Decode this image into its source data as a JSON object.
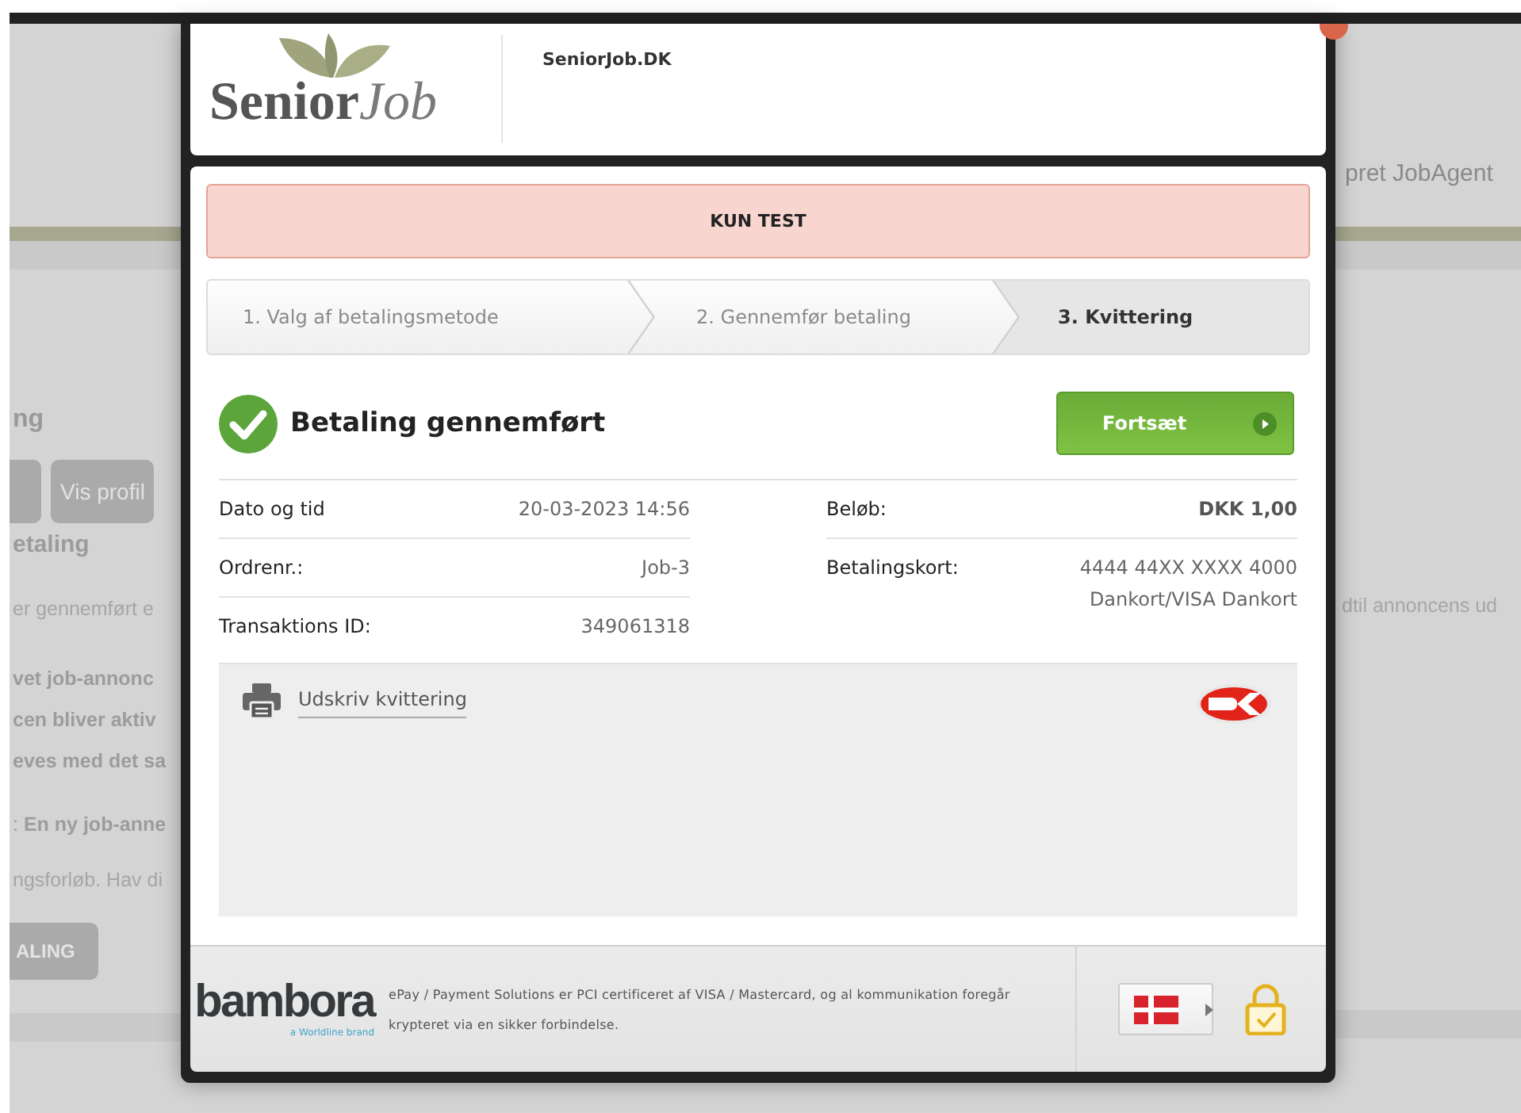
{
  "background_page": {
    "left": [
      {
        "kind": "heading",
        "text": "ng"
      },
      {
        "kind": "button_row",
        "buttons": [
          "Vis profil"
        ]
      },
      {
        "kind": "subheading",
        "text": "etaling"
      },
      {
        "kind": "text",
        "text": "er gennemført e"
      },
      {
        "kind": "bold",
        "text": "vet job-annonc"
      },
      {
        "kind": "bold",
        "text": "cen bliver aktiv"
      },
      {
        "kind": "bold",
        "text": "eves med det sa"
      },
      {
        "kind": "rich",
        "text": ": **En ny job-anne**"
      },
      {
        "kind": "text",
        "text": "ngsforløb. Hav di"
      },
      {
        "kind": "button",
        "text": "ALING"
      }
    ],
    "right": {
      "nav_link": "pret JobAgent",
      "text": "dtil annoncens ud"
    }
  },
  "modal": {
    "header": {
      "logo_text": "Senior",
      "logo_suffix": "Job",
      "site_name": "SeniorJob.DK"
    },
    "notice": "KUN TEST",
    "steps": [
      {
        "label": "1. Valg af betalingsmetode",
        "selected": false
      },
      {
        "label": "2. Gennemfør betaling",
        "selected": false
      },
      {
        "label": "3. Kvittering",
        "selected": true
      }
    ],
    "status": {
      "title": "Betaling gennemført",
      "button": "Fortsæt"
    },
    "details_left": [
      {
        "label": "Dato og tid",
        "value": "20-03-2023 14:56"
      },
      {
        "label": "Ordrenr.:",
        "value": "Job-3"
      },
      {
        "label": "Transaktions ID:",
        "value": "349061318"
      }
    ],
    "details_right": [
      {
        "label": "Beløb:",
        "value": "DKK 1,00",
        "emphasis": true
      },
      {
        "label": "Betalingskort:",
        "value": "4444 44XX XXXX 4000",
        "note": "Dankort/VISA Dankort",
        "emphasis": false
      }
    ],
    "print_link": "Udskriv kvittering",
    "footer": {
      "brand": "bambora",
      "tagline": "a Worldline brand",
      "text": "ePay / Payment Solutions er PCI certificeret af VISA / Mastercard, og al kommunikation foregår krypteret via en sikker forbindelse."
    }
  }
}
